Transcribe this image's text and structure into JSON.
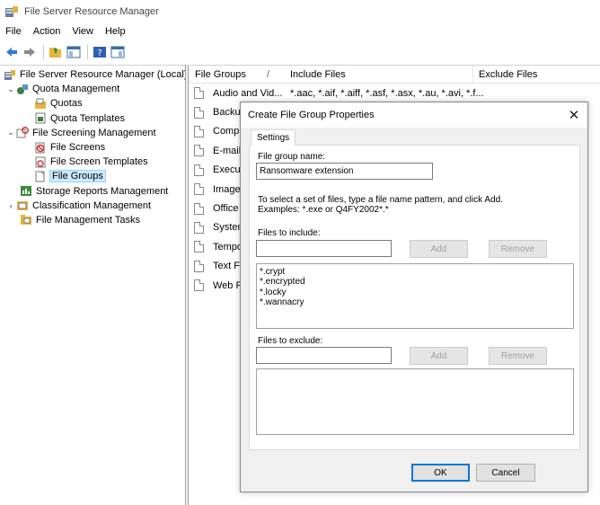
{
  "window": {
    "title": "File Server Resource Manager"
  },
  "menu": [
    "File",
    "Action",
    "View",
    "Help"
  ],
  "tree": {
    "root": "File Server Resource Manager (Local)",
    "quota_management": "Quota Management",
    "quotas": "Quotas",
    "quota_templates": "Quota Templates",
    "file_screening_management": "File Screening Management",
    "file_screens": "File Screens",
    "file_screen_templates": "File Screen Templates",
    "file_groups": "File Groups",
    "storage_reports_management": "Storage Reports Management",
    "classification_management": "Classification Management",
    "file_management_tasks": "File Management Tasks"
  },
  "list": {
    "columns": [
      "File Groups",
      "/",
      "Include Files",
      "Exclude Files"
    ],
    "rows": [
      {
        "name": "Audio and Vid...",
        "include": "*.aac, *.aif, *.aiff, *.asf, *.asx, *.au, *.avi, *.f..."
      },
      {
        "name": "Backup",
        "include": ""
      },
      {
        "name": "Comp",
        "include": ""
      },
      {
        "name": "E-mail",
        "include": ""
      },
      {
        "name": "Execut",
        "include": ""
      },
      {
        "name": "Image",
        "include": ""
      },
      {
        "name": "Office",
        "include": ""
      },
      {
        "name": "System",
        "include": ""
      },
      {
        "name": "Tempo",
        "include": ""
      },
      {
        "name": "Text Fi",
        "include": ""
      },
      {
        "name": "Web P",
        "include": ""
      }
    ]
  },
  "dialog": {
    "title": "Create File Group Properties",
    "close_glyph": "✕",
    "tab": "Settings",
    "group_name_label": "File group name:",
    "group_name_value": "Ransomware extension",
    "help_line1": "To select a set of files, type a file name pattern, and click Add.",
    "help_line2": "Examples: *.exe or Q4FY2002*.*",
    "include_label": "Files to include:",
    "include_input_value": "",
    "include_items": [
      "*.crypt",
      "*.encrypted",
      "*.locky",
      "*.wannacry"
    ],
    "add_label": "Add",
    "remove_label": "Remove",
    "exclude_label": "Files to exclude:",
    "exclude_input_value": "",
    "ok_label": "OK",
    "cancel_label": "Cancel"
  }
}
